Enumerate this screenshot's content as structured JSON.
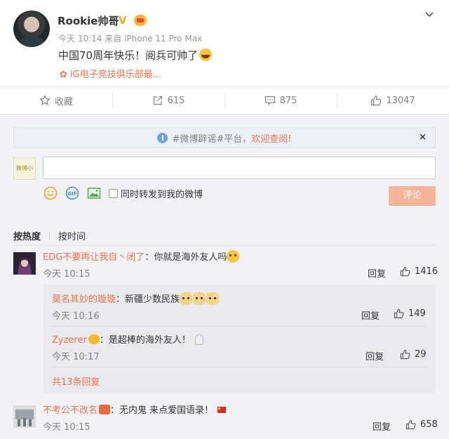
{
  "post": {
    "author": "Rookie帅哥",
    "verified_mark": "V",
    "time": "今天 10:14",
    "from_prefix": "来自",
    "device": "iPhone 11 Pro Max",
    "text": "中国70周年快乐！阅兵可帅了",
    "source_label": "iG电子竞技俱乐部最...",
    "source_icon": "flower-icon"
  },
  "actions": {
    "favorite": "收藏",
    "repost": "615",
    "comment": "875",
    "like": "13047"
  },
  "notice": {
    "prefix": "#微博辟谣#平台，",
    "link": "欢迎查阅!",
    "close": "×"
  },
  "composer": {
    "avatar_text": "微博小秘",
    "input_value": "",
    "repost_label": "同时转发到我的微博",
    "submit_label": "评论",
    "gif_label": "GIF"
  },
  "sort": {
    "hot": "按热度",
    "time": "按时间"
  },
  "comments": [
    {
      "name": "EDG不要再让我自丶闭了",
      "text": "：你就是海外友人吗",
      "time": "今天 10:15",
      "reply": "回复",
      "likes": "1416"
    },
    {
      "name": "不考公不改名",
      "text": "：无内鬼 来点爱国语录！",
      "time": "今天 10:15",
      "reply": "回复",
      "likes": "658"
    }
  ],
  "replies": [
    {
      "name": "莫名其妙的璇璇",
      "text": "：新疆少数民族",
      "time": "今天 10:16",
      "reply": "回复",
      "likes": "149"
    },
    {
      "name": "Zyzerer",
      "text": "：是超棒的海外友人！",
      "time": "今天 10:17",
      "reply": "回复",
      "likes": "29"
    }
  ],
  "more_replies": "共13条回复",
  "colors": {
    "accent": "#eb7350",
    "submit_disabled": "#f5b59a",
    "comment_bg": "#f2f2f5",
    "notice_bg": "#eaf0f6"
  }
}
